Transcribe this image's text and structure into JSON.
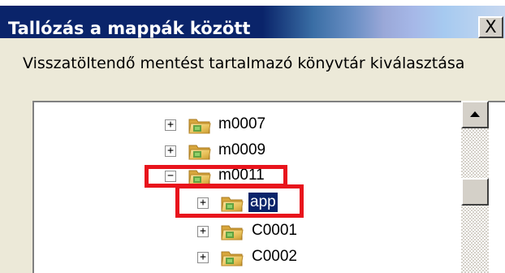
{
  "window": {
    "title": "Tallózás a mappák között",
    "close_glyph": "X"
  },
  "dialog": {
    "instruction": "Visszatöltendő mentést tartalmazó könyvtár kiválasztása"
  },
  "tree": {
    "nodes": [
      {
        "label": "m0007",
        "expander": "+",
        "selected": false
      },
      {
        "label": "m0009",
        "expander": "+",
        "selected": false
      },
      {
        "label": "m0011",
        "expander": "−",
        "selected": false,
        "expanded": true
      },
      {
        "label": "app",
        "expander": "+",
        "selected": true
      },
      {
        "label": "C0001",
        "expander": "+",
        "selected": false
      },
      {
        "label": "C0002",
        "expander": "+",
        "selected": false
      }
    ]
  },
  "annotations": {
    "highlight_color": "#e8141c"
  },
  "icons": {
    "folder": "folder-icon",
    "close": "close-icon",
    "scroll_up": "up-arrow-icon"
  },
  "colors": {
    "title_start": "#0a246a",
    "title_end": "#a6caf0",
    "selection": "#0a246a",
    "dialog_bg": "#ece9d8"
  }
}
